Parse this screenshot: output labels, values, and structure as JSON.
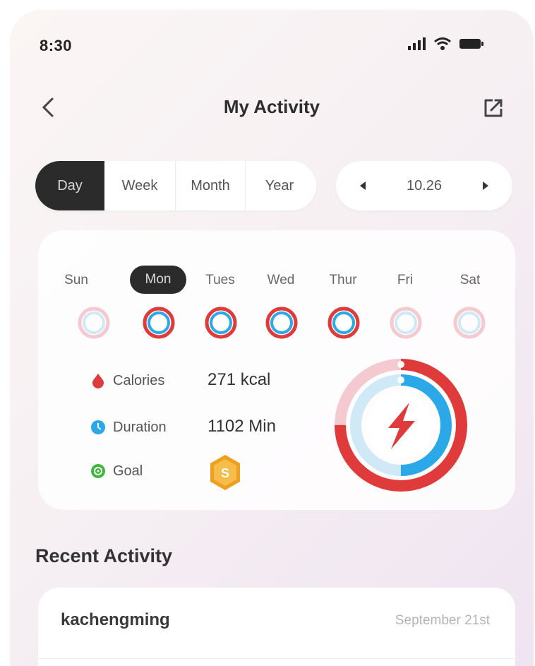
{
  "status_bar": {
    "time": "8:30"
  },
  "header": {
    "title": "My Activity"
  },
  "period_tabs": [
    {
      "label": "Day",
      "active": true
    },
    {
      "label": "Week",
      "active": false
    },
    {
      "label": "Month",
      "active": false
    },
    {
      "label": "Year",
      "active": false
    }
  ],
  "date_nav": {
    "value": "10.26"
  },
  "week": {
    "days": [
      {
        "label": "Sun",
        "active": false,
        "has_activity": false
      },
      {
        "label": "Mon",
        "active": true,
        "has_activity": true
      },
      {
        "label": "Tues",
        "active": false,
        "has_activity": true
      },
      {
        "label": "Wed",
        "active": false,
        "has_activity": true
      },
      {
        "label": "Thur",
        "active": false,
        "has_activity": true
      },
      {
        "label": "Fri",
        "active": false,
        "has_activity": false
      },
      {
        "label": "Sat",
        "active": false,
        "has_activity": false
      }
    ]
  },
  "metrics": {
    "calories": {
      "label": "Calories",
      "value": "271 kcal",
      "color": "#e03b3b"
    },
    "duration": {
      "label": "Duration",
      "value": "1102 Min",
      "color": "#2aa8e8"
    },
    "goal": {
      "label": "Goal",
      "badge_color": "#f0a020",
      "dot_color": "#3fb83f"
    }
  },
  "summary_ring": {
    "outer_progress": 0.75,
    "inner_progress": 0.5,
    "outer_color": "#e03b3b",
    "inner_color": "#2aa8e8",
    "icon": "lightning-bolt-icon"
  },
  "recent": {
    "title": "Recent Activity",
    "items": [
      {
        "name": "kachengming",
        "date": "September 21st"
      }
    ]
  }
}
